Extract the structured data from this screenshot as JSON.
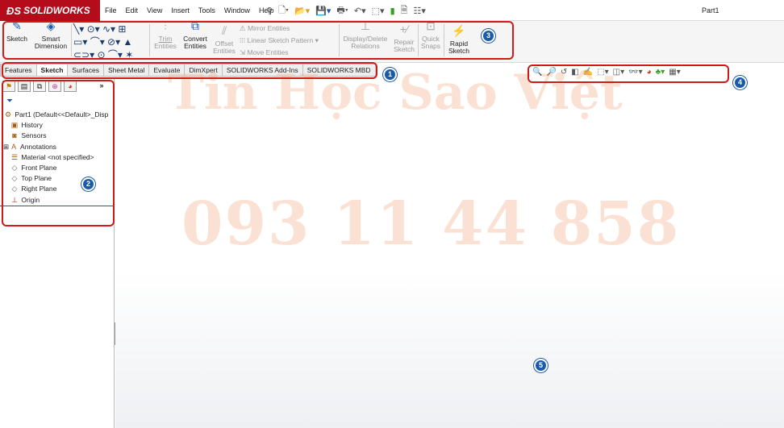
{
  "app": {
    "name": "SOLIDWORKS",
    "doc_title": "Part1"
  },
  "menu": [
    "File",
    "Edit",
    "View",
    "Insert",
    "Tools",
    "Window",
    "Help"
  ],
  "ribbon": {
    "sketch": "Sketch",
    "smart_dimension": [
      "Smart",
      "Dimension"
    ],
    "trim": [
      "Trim",
      "Entities"
    ],
    "convert": [
      "Convert",
      "Entities"
    ],
    "offset": [
      "Offset",
      "Entities"
    ],
    "mirror": "Mirror Entities",
    "linear_pattern": "Linear Sketch Pattern",
    "move": "Move Entities",
    "display_delete": [
      "Display/Delete",
      "Relations"
    ],
    "repair": [
      "Repair",
      "Sketch"
    ],
    "quick_snaps": [
      "Quick",
      "Snaps"
    ],
    "rapid_sketch": [
      "Rapid",
      "Sketch"
    ]
  },
  "tabs": [
    "Features",
    "Sketch",
    "Surfaces",
    "Sheet Metal",
    "Evaluate",
    "DimXpert",
    "SOLIDWORKS Add-Ins",
    "SOLIDWORKS MBD"
  ],
  "active_tab": "Sketch",
  "tree": {
    "root": "Part1  (Default<<Default>_Disp",
    "items": [
      "History",
      "Sensors",
      "Annotations",
      "Material <not specified>",
      "Front Plane",
      "Top Plane",
      "Right Plane",
      "Origin"
    ]
  },
  "watermark": {
    "line1": "Tin Học Sao Việt",
    "line2": "093 11 44 858"
  },
  "badges": [
    "1",
    "2",
    "3",
    "4",
    "5"
  ],
  "colors": {
    "highlight": "#d01a1a",
    "badge": "#1a5aa8",
    "brand": "#b40c1a"
  }
}
